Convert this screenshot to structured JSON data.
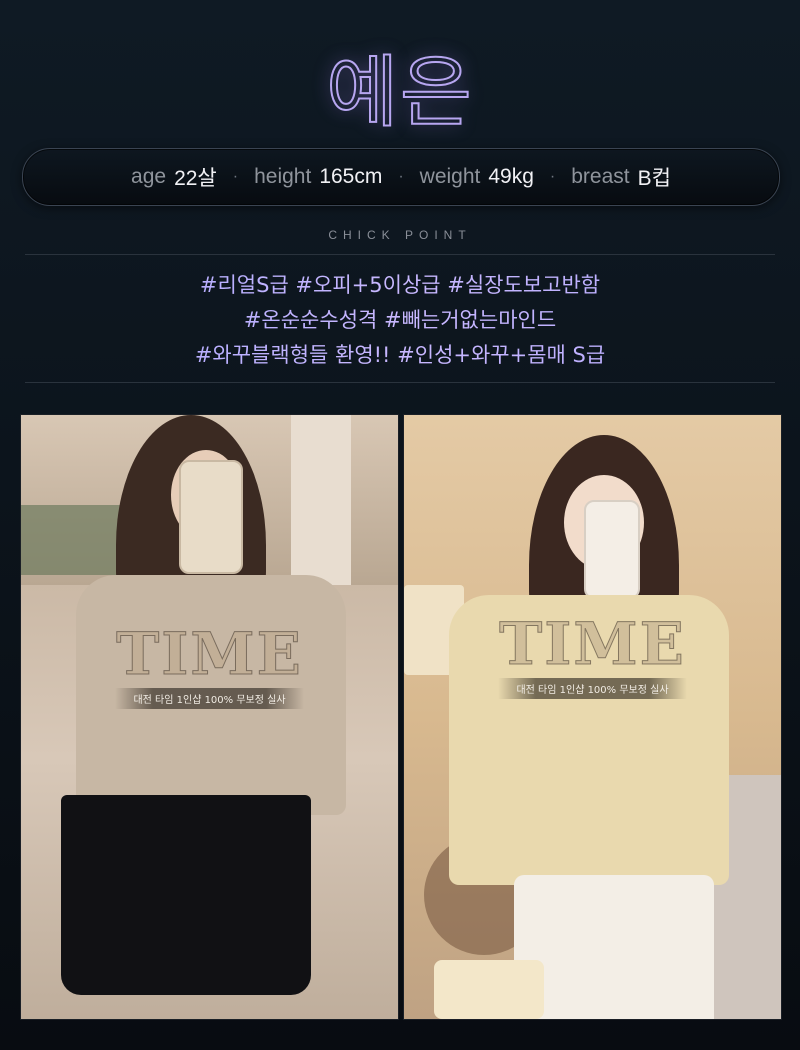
{
  "profile": {
    "name": "예은",
    "stats": [
      {
        "key": "age",
        "value": "22살"
      },
      {
        "key": "height",
        "value": "165cm"
      },
      {
        "key": "weight",
        "value": "49kg"
      },
      {
        "key": "breast",
        "value": "B컵"
      }
    ],
    "separator": "·"
  },
  "section": {
    "label": "CHICK POINT"
  },
  "tags": [
    "#리얼S급 #오피+5이상급 #실장도보고반함",
    "#온순순수성격 #빼는거없는마인드",
    "#와꾸블랙형들 환영!! #인성+와꾸+몸매 S급"
  ],
  "photos": [
    {
      "watermark_logo": "TIME",
      "watermark_caption": "대전 타임 1인샵 100% 무보정 실사"
    },
    {
      "watermark_logo": "TIME",
      "watermark_caption": "대전 타임 1인샵 100% 무보정 실사"
    }
  ],
  "colors": {
    "accent": "#b7a6f0",
    "tag": "#b9adff",
    "background": "#0c141c"
  }
}
